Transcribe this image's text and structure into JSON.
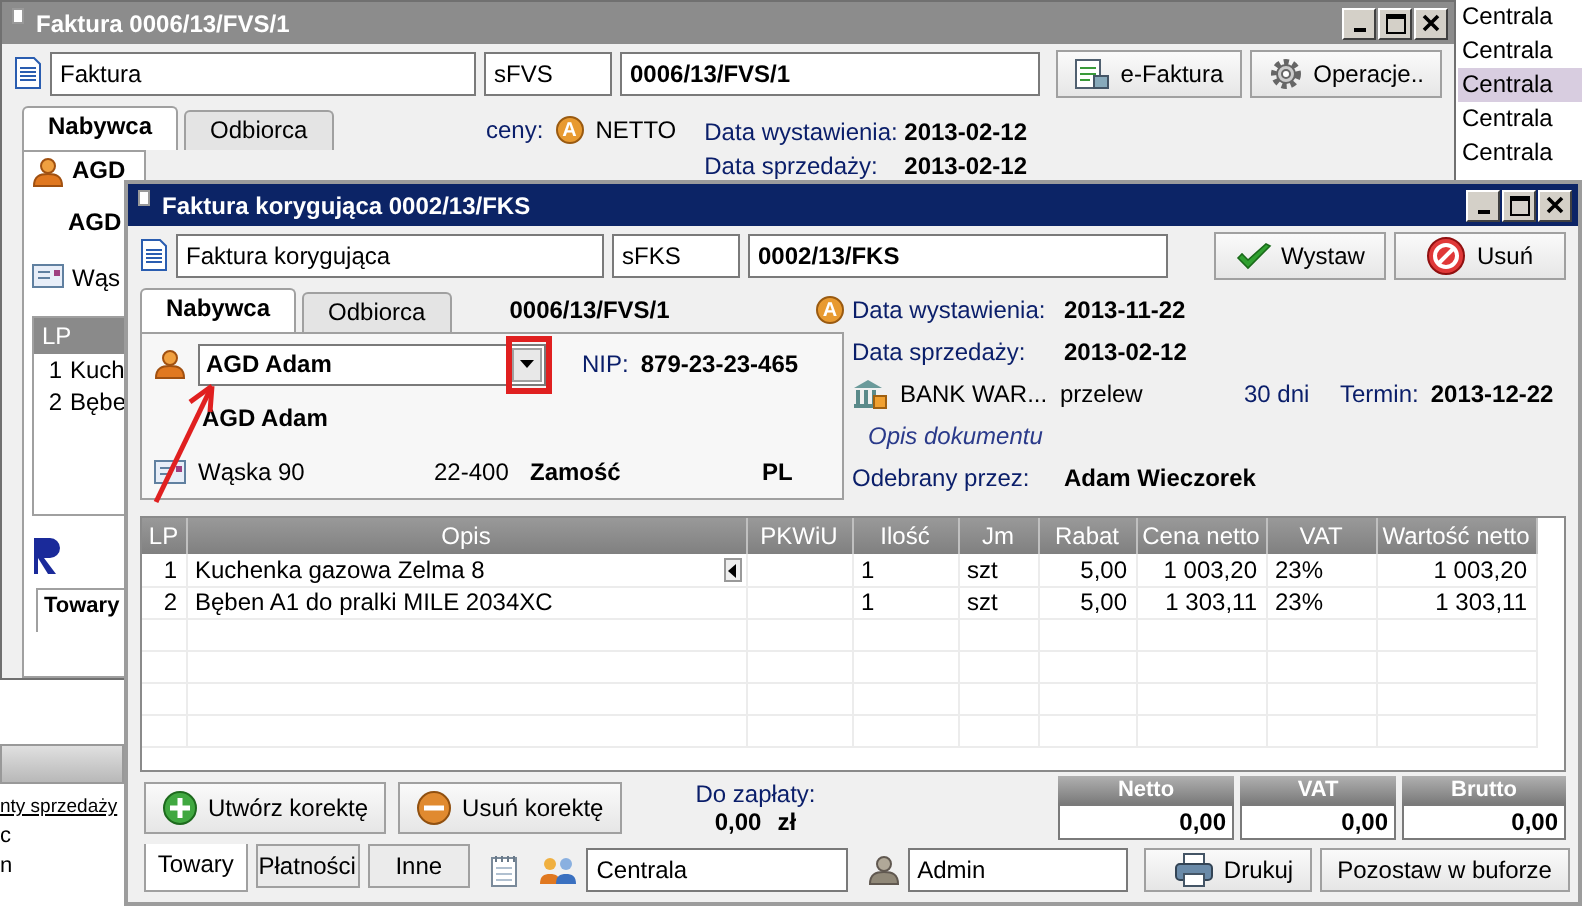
{
  "background_window": {
    "title": "Faktura 0006/13/FVS/1",
    "doc_type": "Faktura",
    "series": "sFVS",
    "number": "0006/13/FVS/1",
    "buttons": [
      {
        "label": "e-Faktura",
        "kind": "efaktura"
      },
      {
        "label": "Operacje..",
        "kind": "gear"
      }
    ],
    "tabs": [
      {
        "label": "Nabywca",
        "selected": true
      },
      {
        "label": "Odbiorca",
        "selected": false
      }
    ],
    "prices_label": "ceny:",
    "currency_badge": "A",
    "prices_mode": "NETTO",
    "dates": [
      {
        "label": "Data wystawienia:",
        "value": "2013-02-12"
      },
      {
        "label": "Data sprzedaży:",
        "value": "2013-02-12"
      }
    ],
    "buyer_name": "AGD",
    "buyer_name_2": "AGD",
    "street": "Wąs",
    "table": {
      "columns": [
        "LP"
      ],
      "rows": [
        {
          "lp": "1",
          "description": "Kuch"
        },
        {
          "lp": "2",
          "description": "Bębe"
        }
      ]
    },
    "bottom_tab": "Towary"
  },
  "side_list": {
    "items": [
      {
        "label": "Centrala",
        "selected": false
      },
      {
        "label": "Centrala",
        "selected": false
      },
      {
        "label": "Centrala",
        "selected": true
      },
      {
        "label": "Centrala",
        "selected": false
      },
      {
        "label": "Centrala",
        "selected": false
      }
    ]
  },
  "behind_panel": {
    "link": "nty sprzedaży",
    "lines": [
      "c",
      "n"
    ]
  },
  "dialog": {
    "title": "Faktura korygująca 0002/13/FKS",
    "doc_type": "Faktura korygująca",
    "series": "sFKS",
    "number": "0002/13/FKS",
    "actions": [
      {
        "label": "Wystaw",
        "kind": "confirm"
      },
      {
        "label": "Usuń",
        "kind": "delete"
      }
    ],
    "tabs": [
      {
        "label": "Nabywca",
        "selected": true
      },
      {
        "label": "Odbiorca",
        "selected": false
      }
    ],
    "source_number": "0006/13/FVS/1",
    "currency_badge": "A",
    "buyer": {
      "combo_value": "AGD Adam",
      "nip_label": "NIP:",
      "nip": "879-23-23-465",
      "name": "AGD Adam",
      "street": "Wąska 90",
      "postcode": "22-400",
      "city": "Zamość",
      "country": "PL"
    },
    "details": {
      "issue_label": "Data wystawienia:",
      "issue_date": "2013-11-22",
      "sale_label": "Data sprzedaży:",
      "sale_date": "2013-02-12",
      "bank": "BANK WAR...",
      "payment": "przelew",
      "days": "30 dni",
      "due_label": "Termin:",
      "due_date": "2013-12-22",
      "description_placeholder": "Opis dokumentu",
      "received_label": "Odebrany przez:",
      "received_by": "Adam Wieczorek"
    },
    "table": {
      "columns": [
        "LP",
        "Opis",
        "PKWiU",
        "Ilość",
        "Jm",
        "Rabat",
        "Cena netto",
        "VAT",
        "Wartość netto"
      ],
      "rows": [
        {
          "lp": "1",
          "description": "Kuchenka gazowa Zelma 8",
          "quantity": "1",
          "unit": "szt",
          "discount": "5,00",
          "net_price": "1 003,20",
          "vat": "23%",
          "net_value": "1 003,20"
        },
        {
          "lp": "2",
          "description": "Bęben A1 do pralki MILE 2034XC",
          "quantity": "1",
          "unit": "szt",
          "discount": "5,00",
          "net_price": "1 303,11",
          "vat": "23%",
          "net_value": "1 303,11"
        }
      ]
    },
    "correction_buttons": [
      {
        "label": "Utwórz korektę",
        "kind": "add"
      },
      {
        "label": "Usuń korektę",
        "kind": "remove"
      }
    ],
    "payment_label": "Do zapłaty:",
    "payment_amount": "0,00",
    "currency": "zł",
    "summary": [
      {
        "label": "Netto",
        "value": "0,00"
      },
      {
        "label": "VAT",
        "value": "0,00"
      },
      {
        "label": "Brutto",
        "value": "0,00"
      }
    ],
    "bottom_tabs": [
      {
        "label": "Towary",
        "selected": true
      },
      {
        "label": "Płatności",
        "selected": false
      },
      {
        "label": "Inne",
        "selected": false
      }
    ],
    "branch": "Centrala",
    "user": "Admin",
    "footer_buttons": [
      {
        "label": "Drukuj",
        "kind": "print"
      },
      {
        "label": "Pozostaw w buforze",
        "kind": "plain"
      }
    ]
  }
}
